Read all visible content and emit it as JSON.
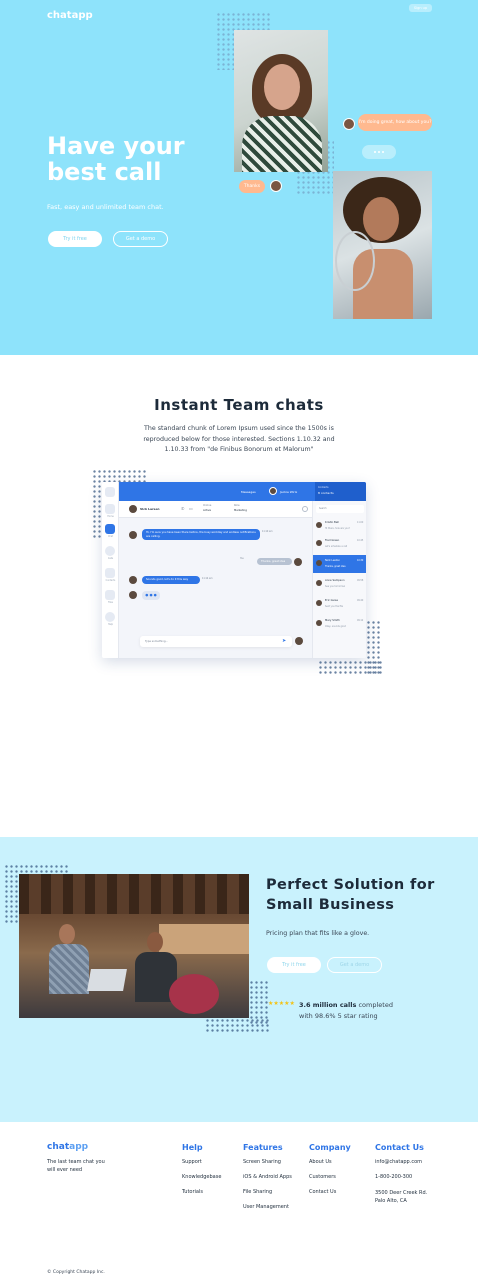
{
  "brand": {
    "name_left": "chat",
    "name_right": "app"
  },
  "hero": {
    "top_button": "Sign up",
    "title_line1": "Have your",
    "title_line2": "best call",
    "subtitle": "Fast, easy and unlimited team chat.",
    "primary_button": "Try it free",
    "secondary_button": "Get a demo",
    "bubble_question": "I'm doing great, how about you?",
    "bubble_small": "Thanks"
  },
  "team": {
    "title": "Instant Team chats",
    "body": "The standard chunk of Lorem Ipsum used since the 1500s is reproduced below for those interested. Sections 1.10.32 and 1.10.33 from \"de Finibus Bonorum et Malorum\"",
    "app": {
      "topbar_messages": "Messages",
      "topbar_user": "Jackie Wirix",
      "topbar_right_title": "Contacts",
      "topbar_right_sub": "8 contacts",
      "chat_name": "Vick Larsen",
      "chat_status_label": "Online",
      "chat_meta1_label": "Status",
      "chat_meta1_value": "Active",
      "chat_meta2_label": "Role",
      "chat_meta2_value": "Marketing",
      "msg1": "Hi, I'm sure you have been there before, the busy workday and endless notifications are calling.",
      "msg1_time": "11:10 am",
      "msg_out_label": "You",
      "msg_out": "Thanks, great idea",
      "msg2": "Sounds good, let's do it this way",
      "msg2_time": "11:14 am",
      "composer_placeholder": "Type something...",
      "search_placeholder": "Search",
      "sidebar_labels": [
        "Home",
        "Chat",
        "Calls",
        "Contacts",
        "Files",
        "Help"
      ],
      "contacts": [
        {
          "name": "Kristin Bell",
          "preview": "Hi there, how are you?",
          "time": "11:00"
        },
        {
          "name": "Fred Green",
          "preview": "Let's schedule a call",
          "time": "10:45"
        },
        {
          "name": "Nick Leston",
          "preview": "Thanks, great idea",
          "time": "10:30"
        },
        {
          "name": "Anne Sampson",
          "preview": "See you tomorrow",
          "time": "09:58"
        },
        {
          "name": "Eric Guise",
          "preview": "Sent you the file",
          "time": "09:40"
        },
        {
          "name": "Mary Smith",
          "preview": "Okay, sounds good",
          "time": "09:12"
        }
      ]
    }
  },
  "business": {
    "title_line1": "Perfect Solution for",
    "title_line2": "Small Business",
    "subtitle": "Pricing plan that fits like a glove.",
    "primary_button": "Try it free",
    "secondary_button": "Get a demo",
    "stars": "★★★★★",
    "rating_bold": "3.6 million calls",
    "rating_rest": " completed",
    "rating_line2": "with 98.6% 5 star rating"
  },
  "footer": {
    "logo_left": "chat",
    "logo_right": "app",
    "tagline": "The last team chat you will ever need",
    "columns": [
      {
        "title": "Help",
        "links": [
          "Support",
          "Knowledgebase",
          "Tutorials"
        ]
      },
      {
        "title": "Features",
        "links": [
          "Screen Sharing",
          "iOS & Android Apps",
          "File Sharing",
          "User Management"
        ]
      },
      {
        "title": "Company",
        "links": [
          "About Us",
          "Customers",
          "Contact Us"
        ]
      },
      {
        "title": "Contact Us",
        "links": [
          "info@chatapp.com",
          "1-800-200-300",
          "3500 Deer Creek Rd. Palo Alto, CA"
        ]
      }
    ],
    "copyright": "© Copyright Chatapp Inc."
  },
  "colors": {
    "hero_bg": "#8ee3fb",
    "accent": "#2f75e6",
    "section_bg": "#c9f2fd",
    "peach": "#ffb98f"
  }
}
